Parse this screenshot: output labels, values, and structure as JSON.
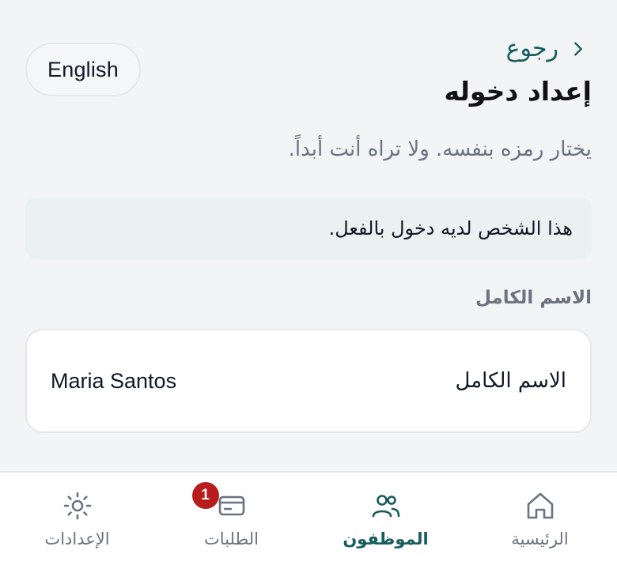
{
  "header": {
    "language_button": "English",
    "back_label": "رجوع",
    "title": "إعداد دخوله",
    "subtitle": "يختار رمزه بنفسه. ولا تراه أنت أبداً."
  },
  "notice": {
    "text": "هذا الشخص لديه دخول بالفعل."
  },
  "form": {
    "section_label": "الاسم الكامل",
    "field_label": "الاسم الكامل",
    "field_value": "Maria Santos"
  },
  "nav": {
    "items": [
      {
        "label": "الرئيسية",
        "icon": "home-icon",
        "active": false
      },
      {
        "label": "الموظفون",
        "icon": "people-icon",
        "active": true
      },
      {
        "label": "الطلبات",
        "icon": "card-icon",
        "active": false,
        "badge": "1"
      },
      {
        "label": "الإعدادات",
        "icon": "sun-icon",
        "active": false
      }
    ]
  },
  "colors": {
    "accent": "#165c5c",
    "badge": "#b91c1c",
    "notice_bg": "#e9f1f1",
    "background": "#f3f4f6"
  }
}
